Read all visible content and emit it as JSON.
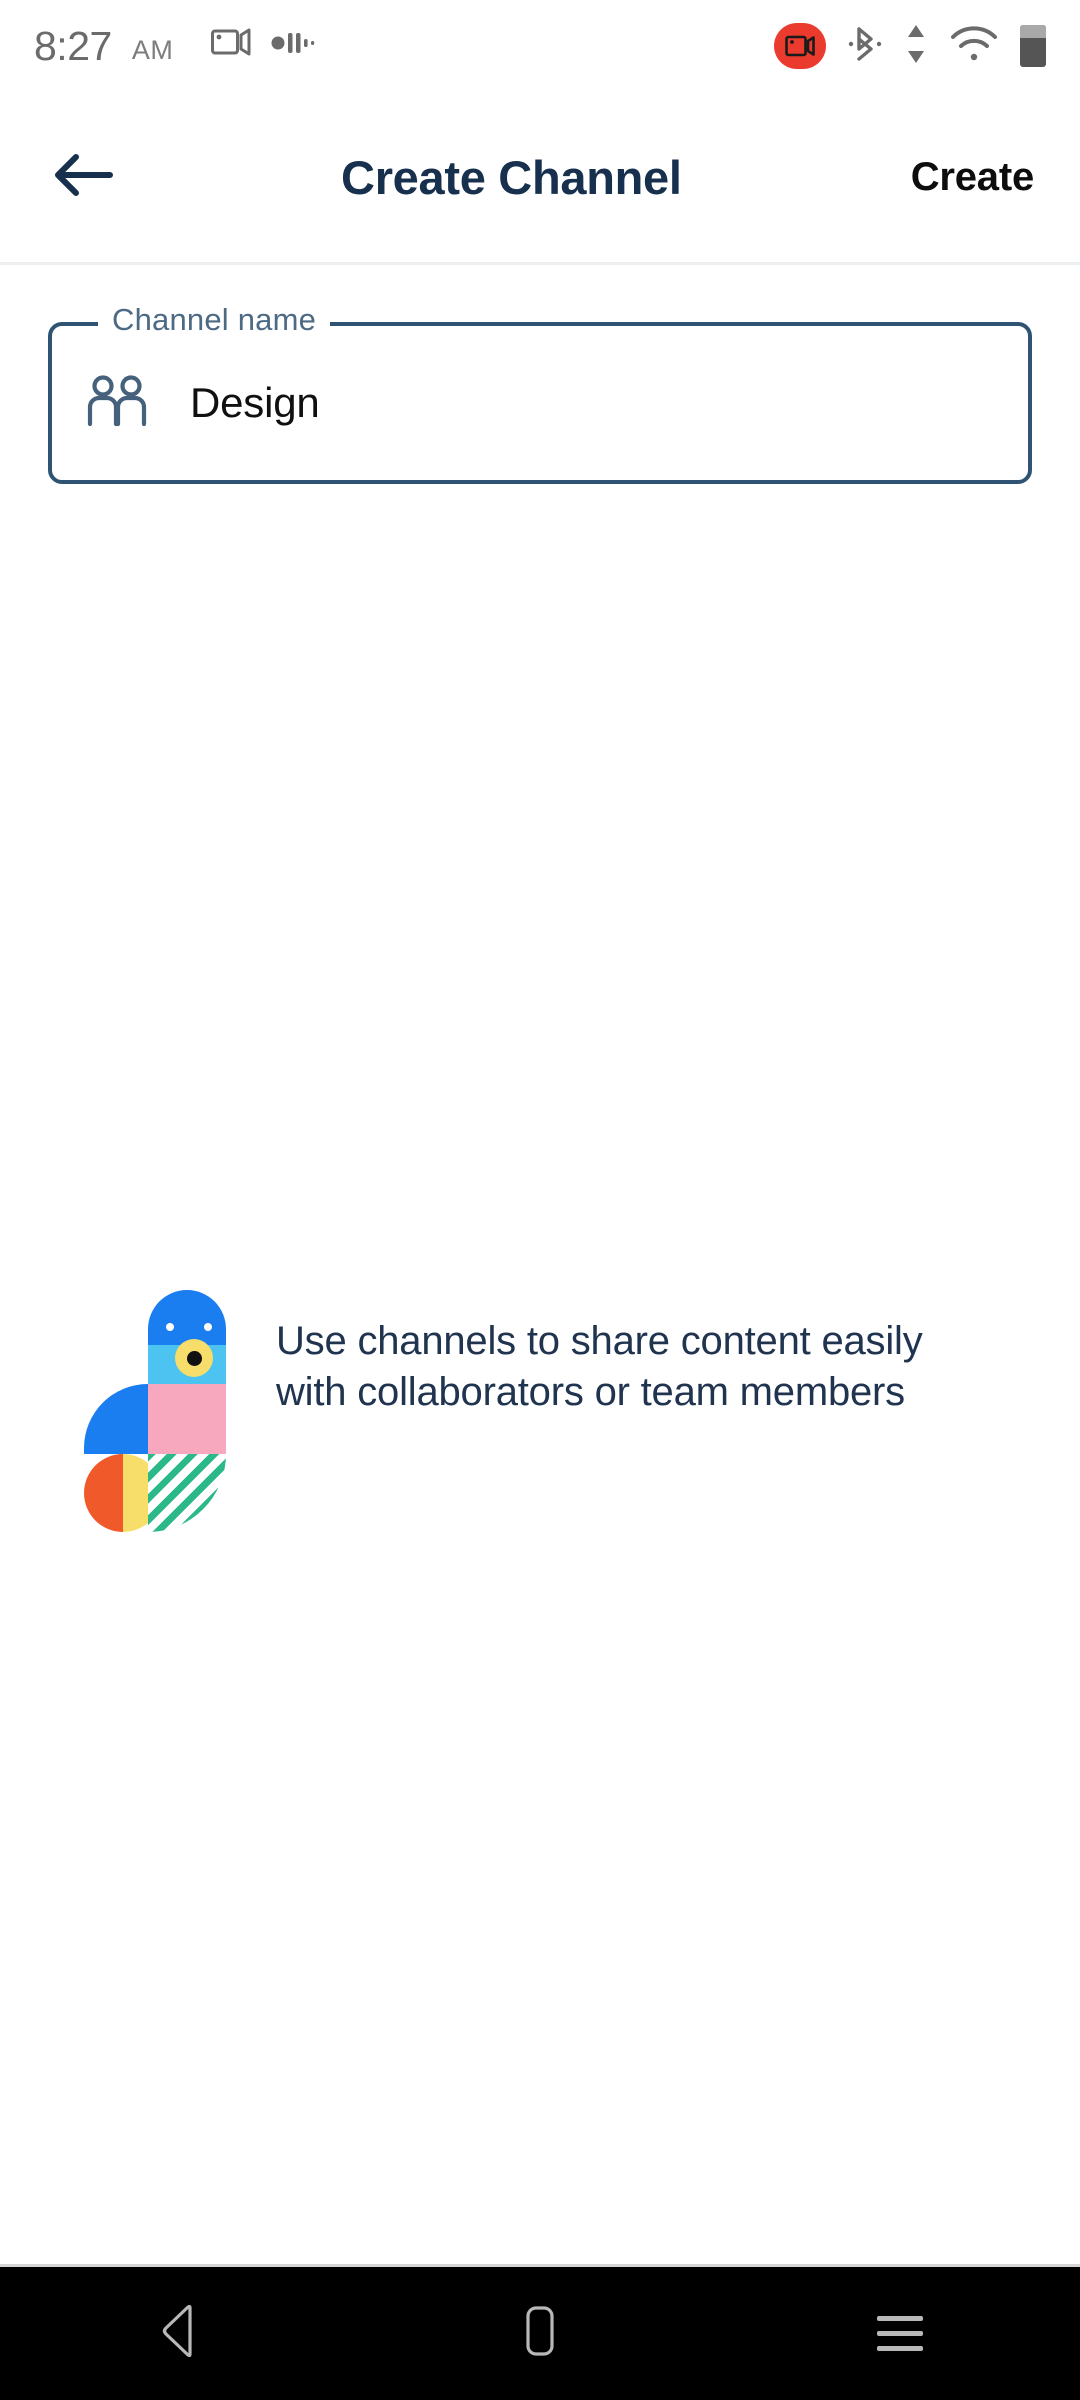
{
  "status_bar": {
    "time": "8:27",
    "ampm": "AM",
    "icons_left": [
      "screen-record-video-icon",
      "audio-waveform-icon"
    ],
    "icons_right": [
      "screen-record-badge-icon",
      "bluetooth-icon",
      "data-transfer-icon",
      "wifi-icon",
      "battery-icon"
    ],
    "record_badge_color": "#ea3b2e"
  },
  "app_bar": {
    "back_label": "back-arrow",
    "title": "Create Channel",
    "action_label": "Create",
    "title_color": "#17304d",
    "action_color": "#0d0d0d"
  },
  "form": {
    "channel_field": {
      "label": "Channel name",
      "value": "Design",
      "placeholder": "Channel name",
      "icon": "people-icon",
      "border_color": "#2f5473"
    }
  },
  "info": {
    "illustration": "abstract-bird-illustration",
    "message": "Use channels to share content easily with collaborators or team members",
    "text_color": "#20344f",
    "palette": {
      "blue": "#1a7ef0",
      "light_blue": "#4cc3f0",
      "pink": "#f7a8bf",
      "yellow": "#f7dd6a",
      "orange": "#f05a2a",
      "green": "#2bb98a"
    }
  },
  "nav_bar": {
    "back": "back-triangle",
    "home": "home-square",
    "recents": "recents-lines",
    "background": "#000000"
  }
}
